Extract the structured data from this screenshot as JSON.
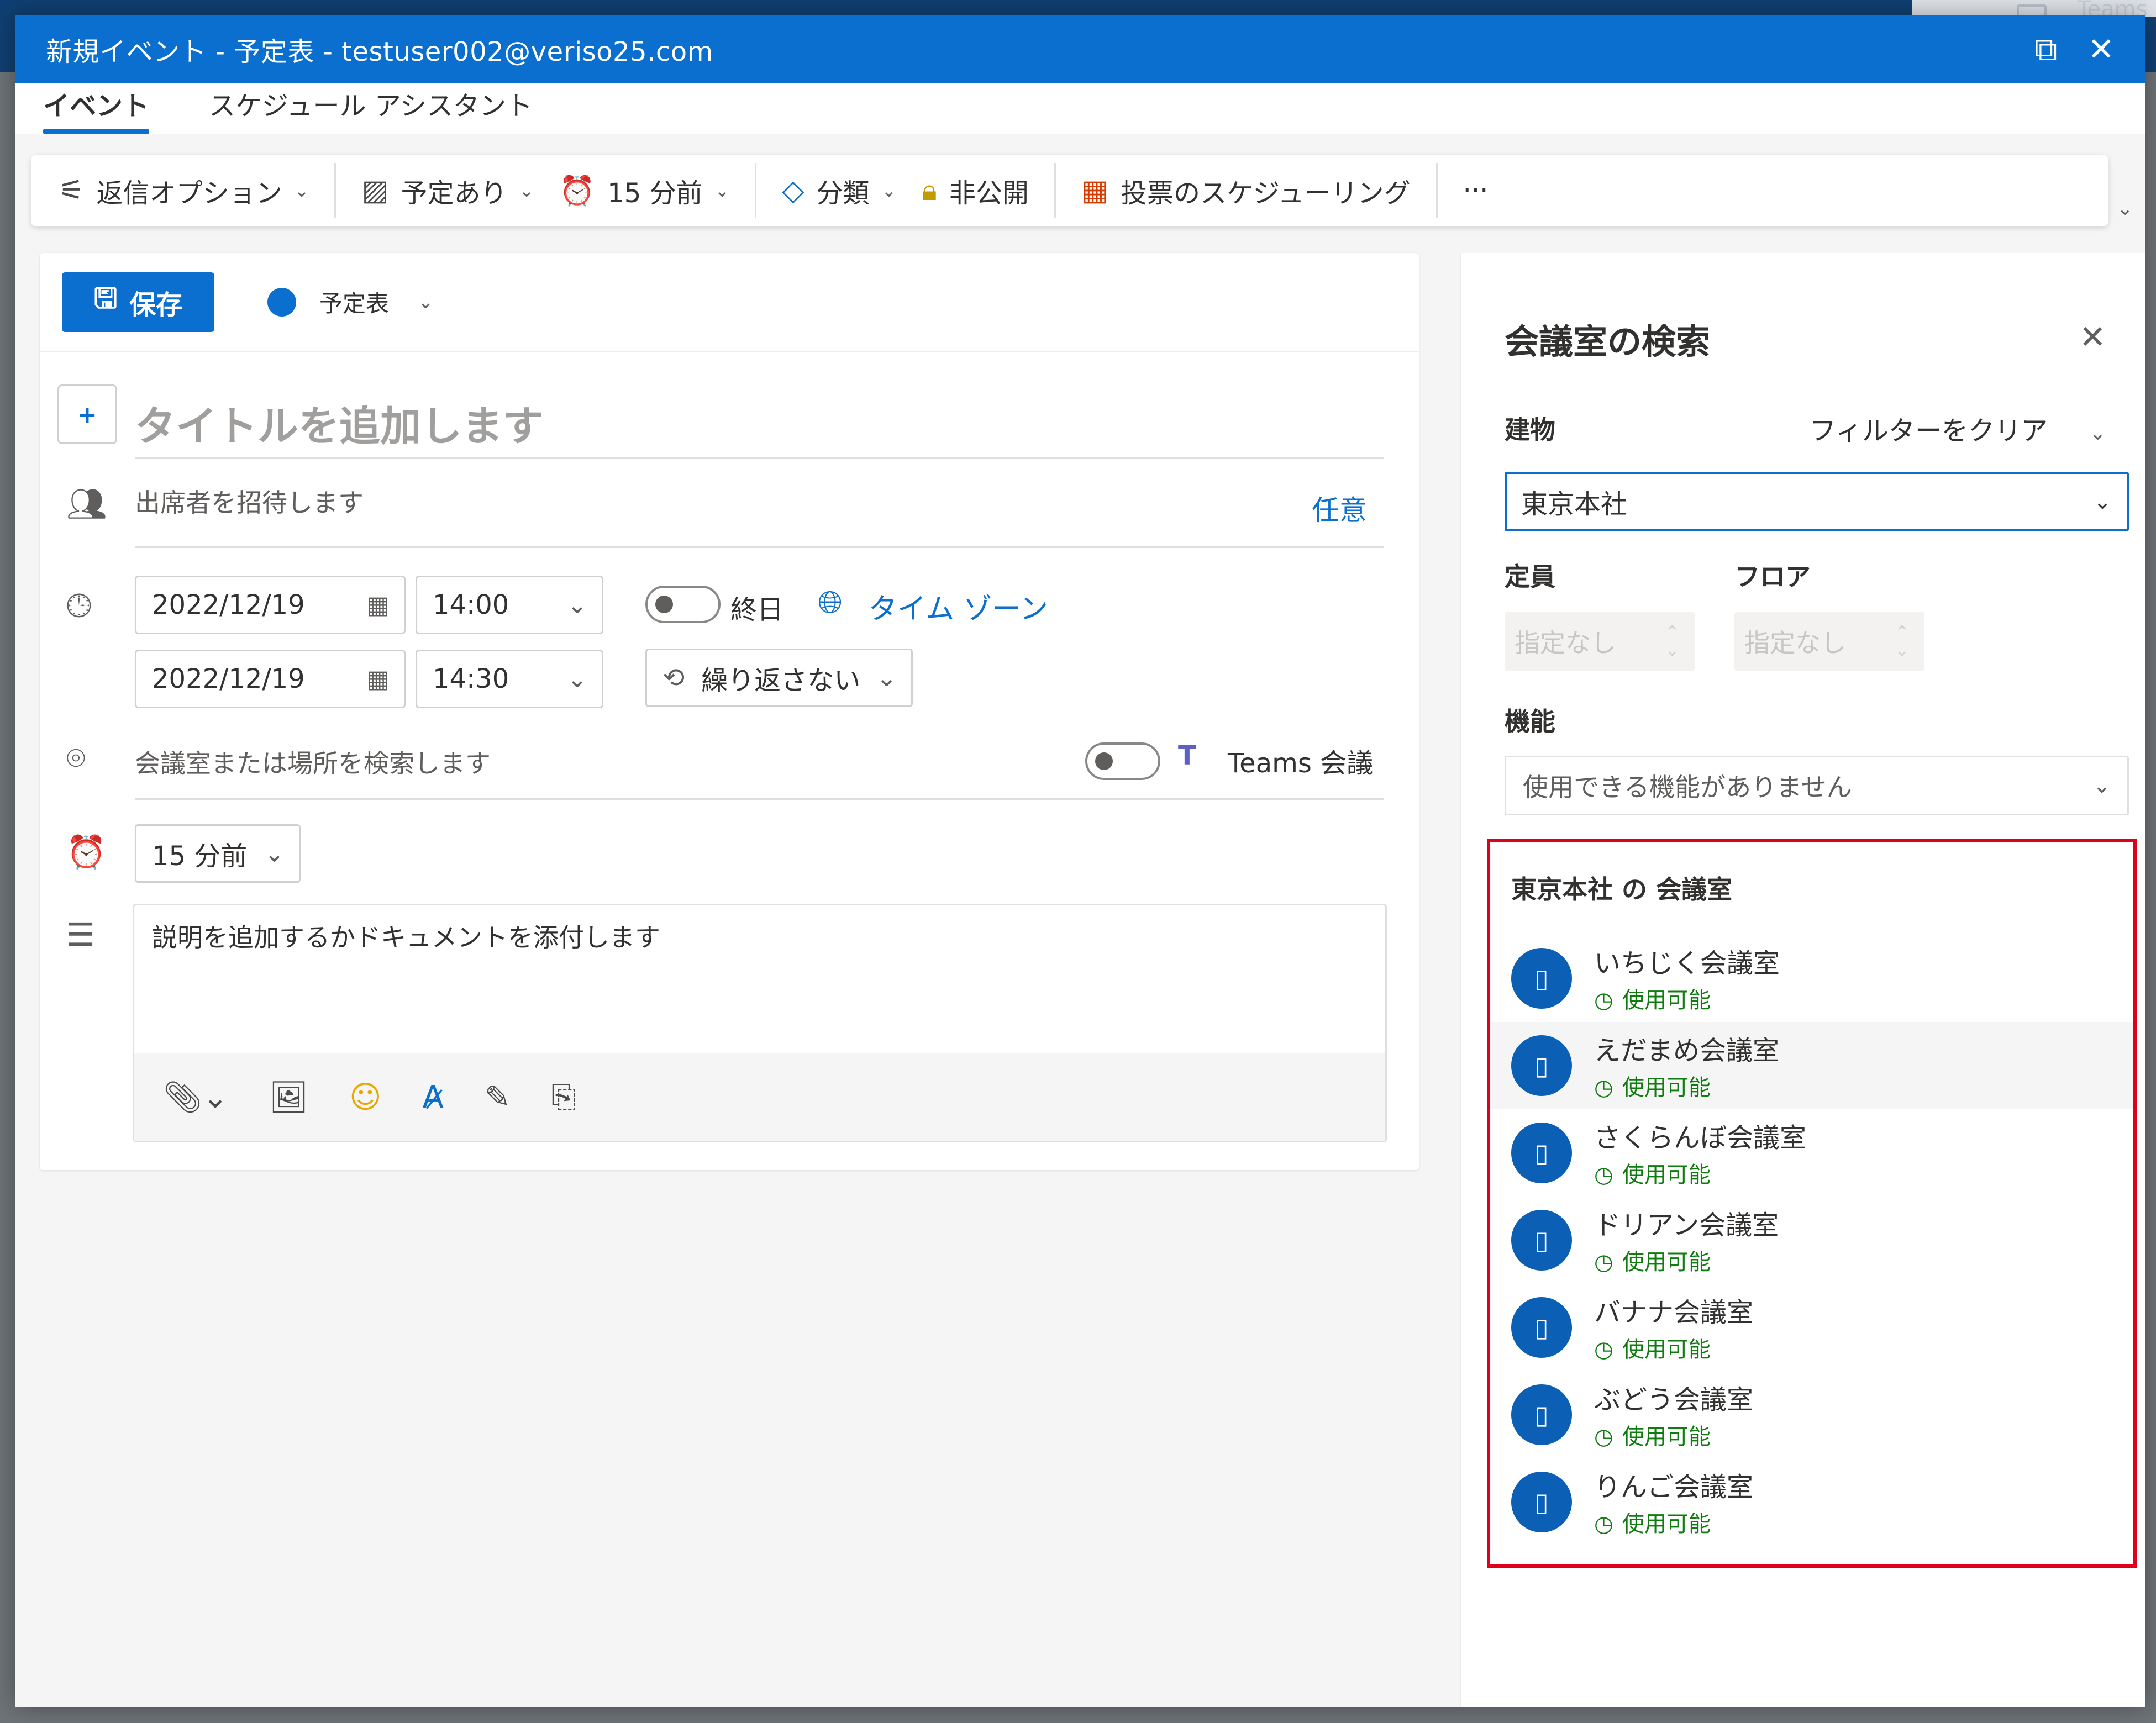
{
  "background": {
    "ghost_text": "Teams"
  },
  "window": {
    "title": "新規イベント - 予定表 - testuser002@veriso25.com",
    "icons": {
      "popout": "popout-icon",
      "close": "close-icon"
    }
  },
  "tabs": [
    {
      "label": "イベント",
      "active": true
    },
    {
      "label": "スケジュール アシスタント",
      "active": false
    }
  ],
  "ribbon": {
    "reply_options": "返信オプション",
    "busy_status": "予定あり",
    "reminder": "15 分前",
    "category": "分類",
    "private": "非公開",
    "poll_scheduling": "投票のスケジューリング",
    "more": "···"
  },
  "form": {
    "save_label": "保存",
    "calendar_name": "予定表",
    "calendar_color": "#0a6fce",
    "title_placeholder": "タイトルを追加します",
    "attendees_placeholder": "出席者を招待します",
    "optional_label": "任意",
    "start_date": "2022/12/19",
    "start_time": "14:00",
    "end_date": "2022/12/19",
    "end_time": "14:30",
    "all_day_label": "終日",
    "timezone_label": "タイム ゾーン",
    "repeat_label": "繰り返さない",
    "location_placeholder": "会議室または場所を検索します",
    "teams_label": "Teams 会議",
    "reminder": "15 分前",
    "description_placeholder": "説明を追加するかドキュメントを添付します"
  },
  "room_finder": {
    "title": "会議室の検索",
    "building_label": "建物",
    "clear_filter": "フィルターをクリア",
    "building_value": "東京本社",
    "capacity_label": "定員",
    "floor_label": "フロア",
    "capacity_value": "指定なし",
    "floor_value": "指定なし",
    "features_label": "機能",
    "features_placeholder": "使用できる機能がありません",
    "rooms_heading": "東京本社 の 会議室",
    "highlight_color": "#e0001b",
    "rooms": [
      {
        "name": "いちじく会議室",
        "status": "使用可能"
      },
      {
        "name": "えだまめ会議室",
        "status": "使用可能"
      },
      {
        "name": "さくらんぼ会議室",
        "status": "使用可能"
      },
      {
        "name": "ドリアン会議室",
        "status": "使用可能"
      },
      {
        "name": "バナナ会議室",
        "status": "使用可能"
      },
      {
        "name": "ぶどう会議室",
        "status": "使用可能"
      },
      {
        "name": "りんご会議室",
        "status": "使用可能"
      }
    ]
  }
}
